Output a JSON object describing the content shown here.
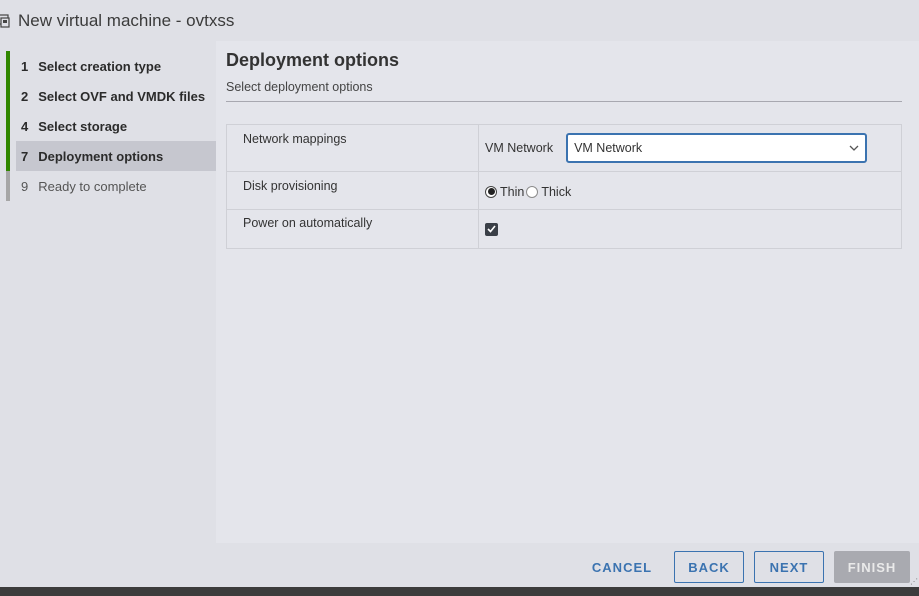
{
  "window": {
    "title": "New virtual machine - ovtxss"
  },
  "steps": [
    {
      "num": "1",
      "label": "Select creation type",
      "state": "done"
    },
    {
      "num": "2",
      "label": "Select OVF and VMDK files",
      "state": "done"
    },
    {
      "num": "4",
      "label": "Select storage",
      "state": "done"
    },
    {
      "num": "7",
      "label": "Deployment options",
      "state": "active"
    },
    {
      "num": "9",
      "label": "Ready to complete",
      "state": "pending"
    }
  ],
  "main": {
    "title": "Deployment options",
    "subtitle": "Select deployment options",
    "network": {
      "label": "Network mappings",
      "vm_label": "VM Network",
      "selected": "VM Network"
    },
    "disk": {
      "label": "Disk provisioning",
      "options": [
        "Thin",
        "Thick"
      ],
      "selected": "Thin"
    },
    "power": {
      "label": "Power on automatically",
      "checked": true
    }
  },
  "footer": {
    "cancel": "CANCEL",
    "back": "BACK",
    "next": "NEXT",
    "finish": "FINISH"
  },
  "colors": {
    "accent": "#3b73b0",
    "step_done": "#318700",
    "step_pending": "#a6a6a6"
  }
}
